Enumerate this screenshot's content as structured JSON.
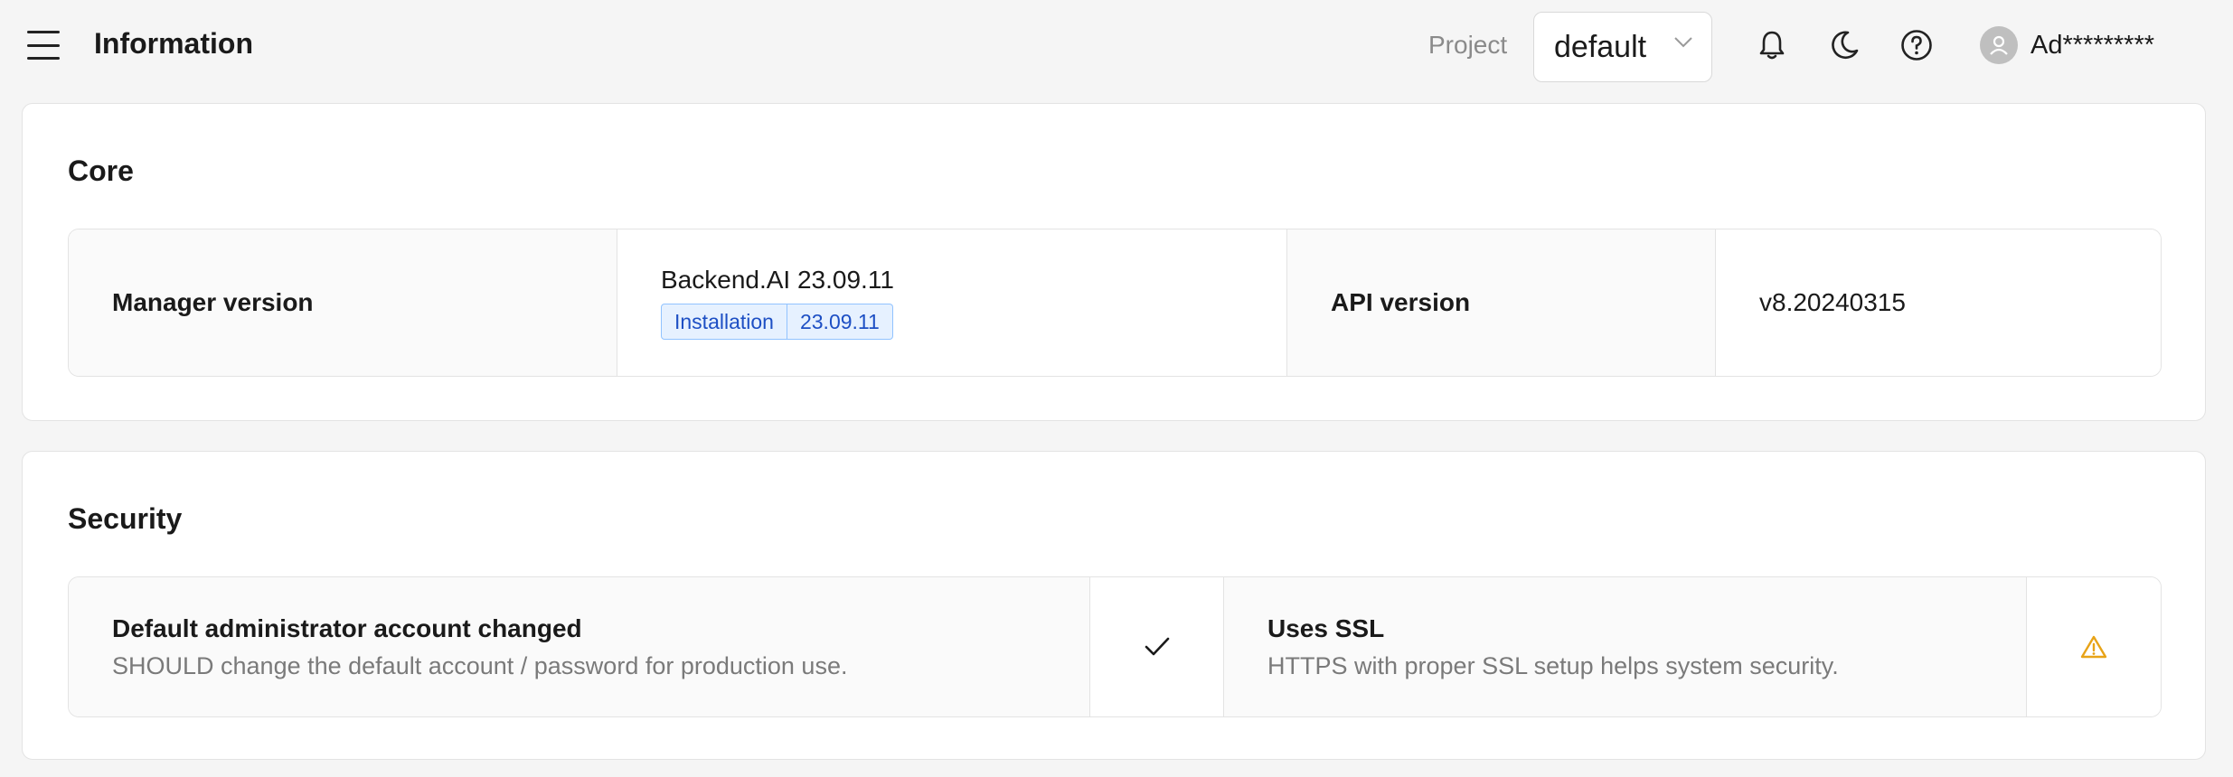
{
  "header": {
    "title": "Information",
    "project_label": "Project",
    "project_value": "default",
    "user_name": "Ad*********"
  },
  "core": {
    "title": "Core",
    "manager_version_label": "Manager version",
    "manager_version_value": "Backend.AI 23.09.11",
    "installation_tag": "Installation",
    "installation_version_tag": "23.09.11",
    "api_version_label": "API version",
    "api_version_value": "v8.20240315"
  },
  "security": {
    "title": "Security",
    "items": [
      {
        "title": "Default administrator account changed",
        "description": "SHOULD change the default account / password for production use.",
        "status": "check"
      },
      {
        "title": "Uses SSL",
        "description": "HTTPS with proper SSL setup helps system security.",
        "status": "warning"
      }
    ]
  },
  "colors": {
    "accent": "#1d4fc4",
    "warning": "#e8a317",
    "tag_bg": "#e6f1ff"
  },
  "icons": [
    "menu-icon",
    "chevron-down-icon",
    "bell-icon",
    "moon-icon",
    "help-icon",
    "user-avatar-icon",
    "check-icon",
    "warning-icon"
  ]
}
